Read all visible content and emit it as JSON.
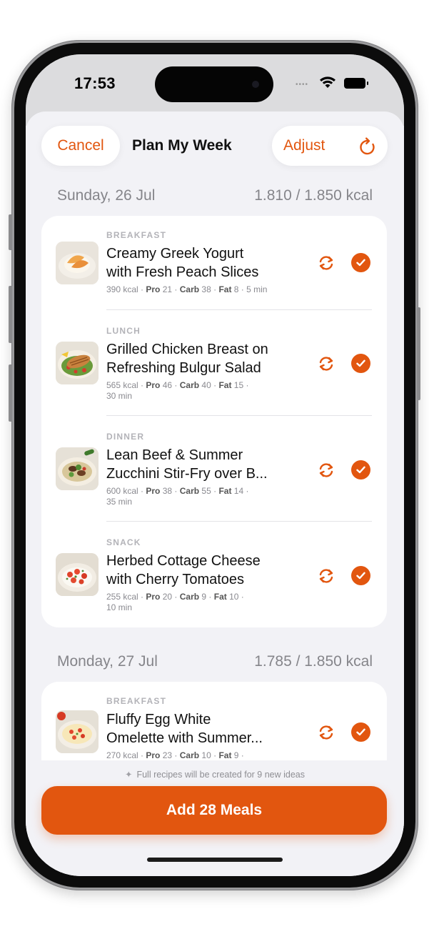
{
  "status_bar": {
    "time": "17:53"
  },
  "header": {
    "cancel_label": "Cancel",
    "title": "Plan My Week",
    "adjust_label": "Adjust"
  },
  "days": [
    {
      "date": "Sunday, 26 Jul",
      "kcal": "1.810 / 1.850 kcal",
      "meals": [
        {
          "type": "BREAKFAST",
          "name_line1": "Creamy Greek Yogurt",
          "name_line2": "with Fresh Peach Slices",
          "kcal": "390 kcal · ",
          "pro_label": "Pro",
          "pro": " 21 · ",
          "carb_label": "Carb",
          "carb": " 38 · ",
          "fat_label": "Fat",
          "fat": " 8 · 5 min",
          "time": ""
        },
        {
          "type": "LUNCH",
          "name_line1": "Grilled Chicken Breast on",
          "name_line2": "Refreshing Bulgur Salad",
          "kcal": "565 kcal · ",
          "pro_label": "Pro",
          "pro": " 46 · ",
          "carb_label": "Carb",
          "carb": " 40 · ",
          "fat_label": "Fat",
          "fat": " 15 ·",
          "time": "30 min"
        },
        {
          "type": "DINNER",
          "name_line1": "Lean Beef & Summer",
          "name_line2": "Zucchini Stir-Fry over B...",
          "kcal": "600 kcal · ",
          "pro_label": "Pro",
          "pro": " 38 · ",
          "carb_label": "Carb",
          "carb": " 55 · ",
          "fat_label": "Fat",
          "fat": " 14 ·",
          "time": "35 min"
        },
        {
          "type": "SNACK",
          "name_line1": "Herbed Cottage Cheese",
          "name_line2": "with Cherry Tomatoes",
          "kcal": "255 kcal · ",
          "pro_label": "Pro",
          "pro": " 20 · ",
          "carb_label": "Carb",
          "carb": " 9 · ",
          "fat_label": "Fat",
          "fat": " 10 ·",
          "time": "10 min"
        }
      ]
    },
    {
      "date": "Monday, 27 Jul",
      "kcal": "1.785 / 1.850 kcal",
      "meals": [
        {
          "type": "BREAKFAST",
          "name_line1": "Fluffy Egg White",
          "name_line2": "Omelette with Summer...",
          "kcal": "270 kcal · ",
          "pro_label": "Pro",
          "pro": " 23 · ",
          "carb_label": "Carb",
          "carb": " 10 · ",
          "fat_label": "Fat",
          "fat": " 9 ·",
          "time": ""
        }
      ]
    }
  ],
  "footer": {
    "note": "Full recipes will be created for 9 new ideas",
    "add_button_label": "Add 28 Meals"
  },
  "colors": {
    "accent": "#e2560f",
    "background": "#f2f2f6",
    "card": "#ffffff",
    "secondary_text": "#85858a"
  },
  "icons": [
    "wifi-icon",
    "battery-icon",
    "refresh-icon",
    "swap-icon",
    "check-icon",
    "sparkle-icon"
  ]
}
